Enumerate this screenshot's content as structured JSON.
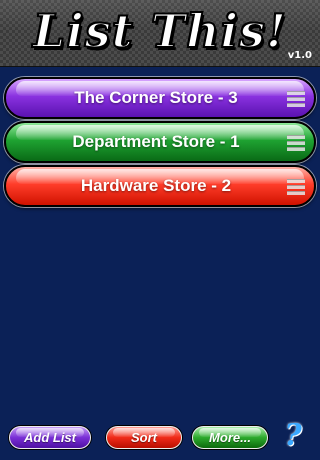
{
  "header": {
    "title": "List This!",
    "version": "v1.0"
  },
  "lists": [
    {
      "label": "The Corner Store - 3",
      "color": "#7a2fd6"
    },
    {
      "label": "Department Store - 1",
      "color": "#1fa332"
    },
    {
      "label": "Hardware Store - 2",
      "color": "#ff3d2a"
    }
  ],
  "toolbar": {
    "add_label": "Add List",
    "sort_label": "Sort",
    "more_label": "More...",
    "help_label": "?"
  },
  "icons": {
    "reorder": "reorder-grip-icon",
    "help": "help-icon"
  },
  "colors": {
    "background": "#0b2157",
    "help": "#3aa8ff"
  }
}
